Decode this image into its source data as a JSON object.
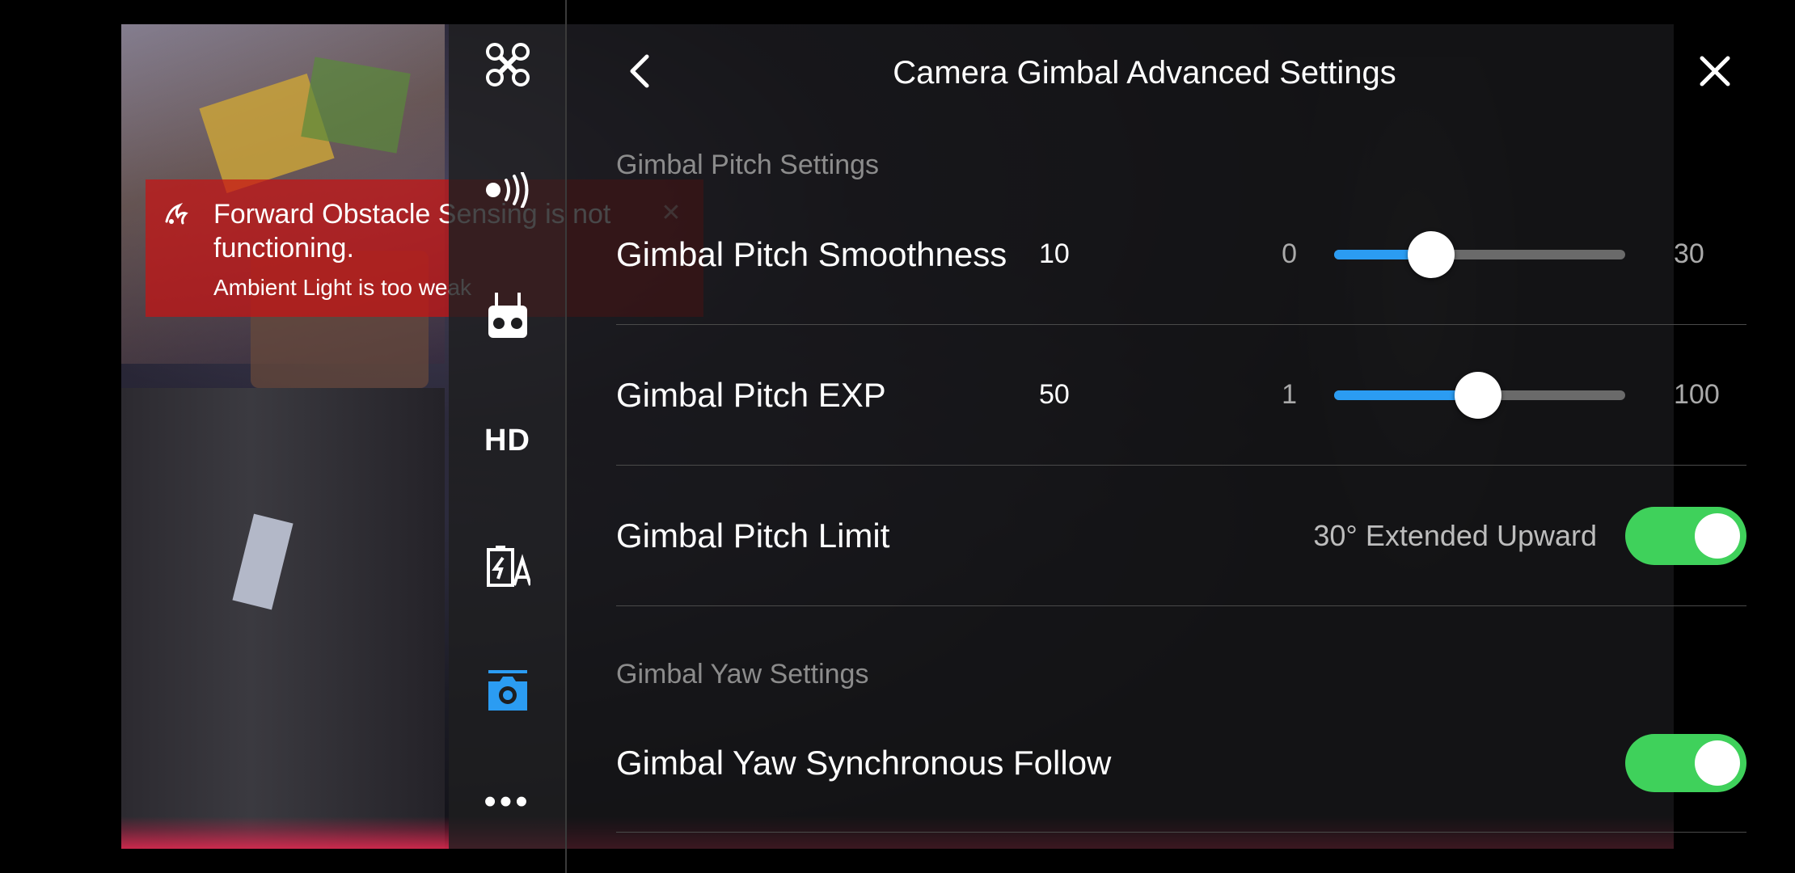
{
  "panel": {
    "title": "Camera Gimbal Advanced Settings"
  },
  "warning": {
    "title": "Forward Obstacle Sensing is not functioning.",
    "subtitle": "Ambient Light is too weak"
  },
  "icon_rail": {
    "items": [
      {
        "icon": "aircraft-icon"
      },
      {
        "icon": "signal-icon"
      },
      {
        "icon": "remote-controller-icon"
      },
      {
        "label": "HD"
      },
      {
        "icon": "battery-icon"
      },
      {
        "icon": "camera-icon",
        "active": true
      },
      {
        "label": "•••"
      }
    ],
    "active_color": "#2b9cf2"
  },
  "sections": {
    "pitch_label": "Gimbal Pitch Settings",
    "yaw_label": "Gimbal Yaw Settings"
  },
  "rows": {
    "pitch_smoothness": {
      "label": "Gimbal Pitch Smoothness",
      "value": "10",
      "min": "0",
      "max": "30",
      "value_num": 10,
      "min_num": 0,
      "max_num": 30
    },
    "pitch_exp": {
      "label": "Gimbal Pitch EXP",
      "value": "50",
      "min": "1",
      "max": "100",
      "value_num": 50,
      "min_num": 1,
      "max_num": 100
    },
    "pitch_limit": {
      "label": "Gimbal Pitch Limit",
      "description": "30° Extended Upward",
      "enabled": true
    },
    "yaw_sync_follow": {
      "label": "Gimbal Yaw Synchronous Follow",
      "enabled": true
    }
  },
  "colors": {
    "accent": "#2b9cf2",
    "toggle_on": "#3fd15b",
    "warning": "#c81414"
  }
}
